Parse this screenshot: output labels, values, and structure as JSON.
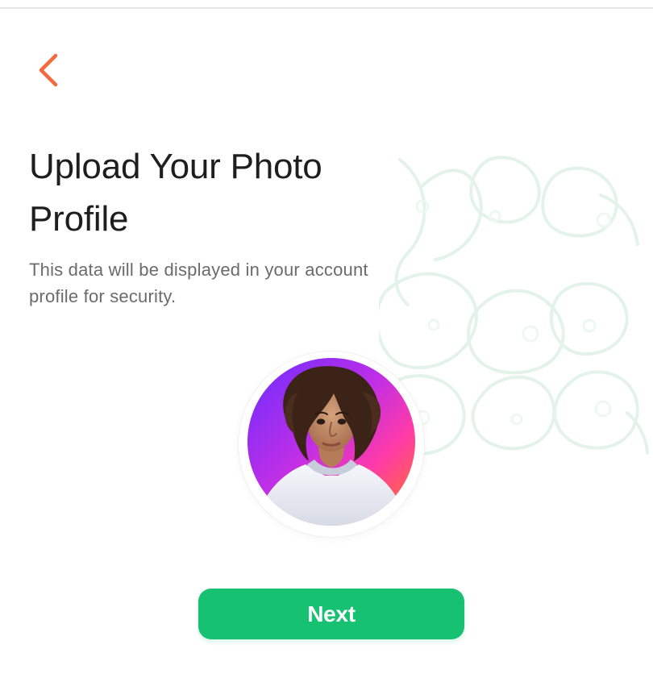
{
  "screen": {
    "title": "Upload Your Photo Profile",
    "subtitle": "This data will be displayed in your account profile for security."
  },
  "actions": {
    "next_label": "Next"
  },
  "icons": {
    "back": "chevron-left-icon",
    "profile_photo": "profile-photo"
  },
  "colors": {
    "accent": "#16c172",
    "back_icon": "#f26a3d",
    "title": "#1e1e1e",
    "subtitle": "#6b6b6b",
    "pattern": "#e8f5ef"
  }
}
